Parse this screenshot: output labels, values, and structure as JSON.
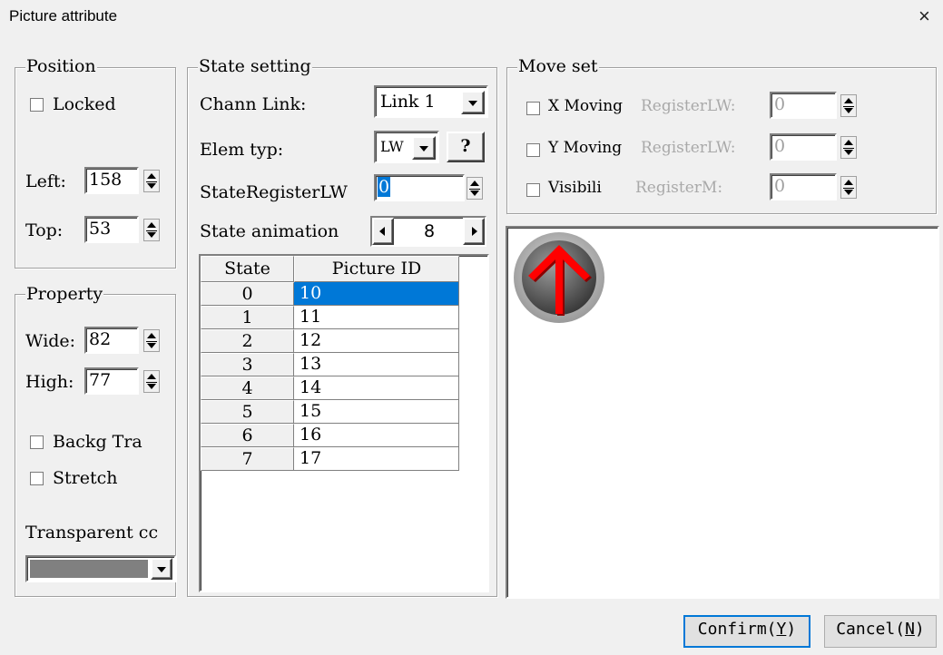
{
  "window": {
    "title": "Picture attribute",
    "close_glyph": "×"
  },
  "position": {
    "legend": "Position",
    "locked_label": "Locked",
    "left_label": "Left:",
    "left_value": "158",
    "top_label": "Top:",
    "top_value": "53"
  },
  "property": {
    "legend": "Property",
    "wide_label": "Wide:",
    "wide_value": "82",
    "high_label": "High:",
    "high_value": "77",
    "backg_label": "Backg Tra",
    "stretch_label": "Stretch",
    "transparent_label": "Transparent cc",
    "transparent_color": "#808080"
  },
  "state": {
    "legend": "State setting",
    "chann_label": "Chann Link:",
    "chann_value": "Link 1",
    "elem_label": "Elem typ:",
    "elem_value": "LW",
    "help_label": "?",
    "register_label": "StateRegisterLW",
    "register_value": "0",
    "animation_label": "State animation",
    "animation_value": "8",
    "table": {
      "headers": [
        "State",
        "Picture ID"
      ],
      "rows": [
        {
          "state": "0",
          "picture_id": "10",
          "selected": true
        },
        {
          "state": "1",
          "picture_id": "11"
        },
        {
          "state": "2",
          "picture_id": "12"
        },
        {
          "state": "3",
          "picture_id": "13"
        },
        {
          "state": "4",
          "picture_id": "14"
        },
        {
          "state": "5",
          "picture_id": "15"
        },
        {
          "state": "6",
          "picture_id": "16"
        },
        {
          "state": "7",
          "picture_id": "17"
        }
      ]
    }
  },
  "move": {
    "legend": "Move set",
    "x_label": "X Moving",
    "x_reg": "RegisterLW:",
    "x_value": "0",
    "y_label": "Y Moving",
    "y_reg": "RegisterLW:",
    "y_value": "0",
    "vis_label": "Visibili",
    "vis_reg": "RegisterM:",
    "vis_value": "0"
  },
  "preview": {
    "icon": "red-up-arrow-circle-icon",
    "arrow_color": "#ff0000",
    "accent": "#0078d7"
  },
  "footer": {
    "confirm_text": "Confirm(",
    "confirm_key": "Y",
    "cancel_text": "Cancel(",
    "cancel_key": "N",
    "close_paren": ")"
  }
}
